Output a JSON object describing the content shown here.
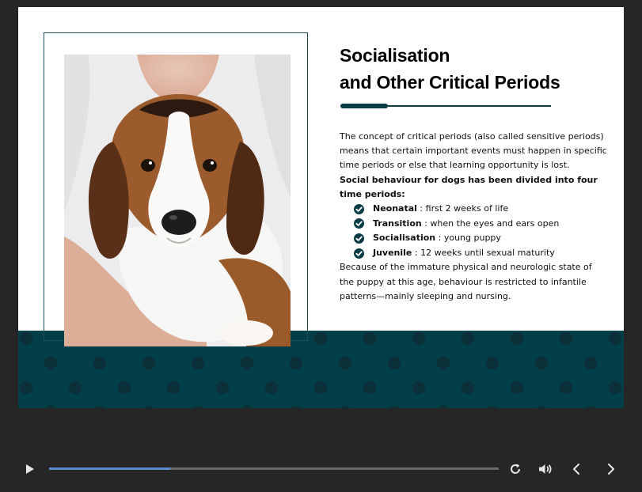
{
  "slide": {
    "title_line1": "Socialisation",
    "title_line2": "and Other Critical Periods",
    "intro": "The concept of critical periods (also called sensitive periods) means that certain important events must happen in specific time periods or else that learning opportunity is lost.",
    "division_heading": "Social behaviour for dogs has been divided into four time periods:",
    "periods": [
      {
        "term": "Neonatal",
        "desc": " : first 2 weeks of life"
      },
      {
        "term": "Transition",
        "desc": " : when the eyes and ears open"
      },
      {
        "term": "Socialisation",
        "desc": " : young puppy"
      },
      {
        "term": "Juvenile",
        "desc": " : 12 weeks until sexual maturity"
      }
    ],
    "conclusion": "Because of the immature physical and neurologic state of the puppy at this age, behaviour is restricted to infantile patterns—mainly sleeping and nursing.",
    "accent_color": "#033f49",
    "image_subject": "beagle puppy held in arms"
  },
  "player": {
    "progress": 0.27,
    "progress_color": "#5b8bd0",
    "icons": [
      "play-icon",
      "replay-icon",
      "volume-icon",
      "previous-icon",
      "next-icon"
    ]
  }
}
